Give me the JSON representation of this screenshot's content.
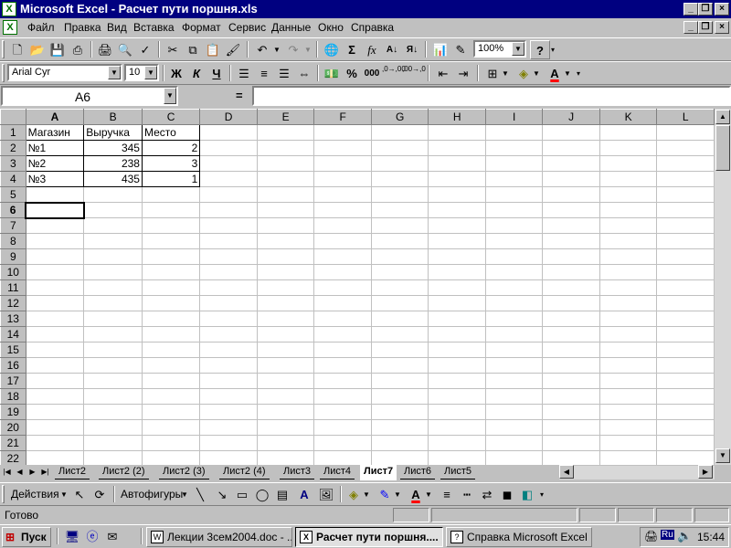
{
  "window": {
    "title": "Microsoft Excel - Расчет пути поршня.xls",
    "minimize": "_",
    "restore": "❐",
    "close": "×"
  },
  "menu": {
    "items": [
      "Файл",
      "Правка",
      "Вид",
      "Вставка",
      "Формат",
      "Сервис",
      "Данные",
      "Окно",
      "Справка"
    ],
    "underline": [
      "Ф",
      "П",
      "В",
      "а",
      "о",
      "С",
      "Д",
      "О",
      "С"
    ]
  },
  "toolbar_standard": {
    "zoom": "100%",
    "help": "?"
  },
  "toolbar_format": {
    "font": "Arial Cyr",
    "size": "10",
    "bold": "Ж",
    "italic": "К",
    "underline": "Ч",
    "percent": "%",
    "thousands": "000",
    "inc_decimal": ",0→,00",
    "dec_decimal": ",00→,0"
  },
  "formula_bar": {
    "name_box": "A6",
    "equals": "=",
    "value": ""
  },
  "sheet": {
    "columns": [
      "A",
      "B",
      "C",
      "D",
      "E",
      "F",
      "G",
      "H",
      "I",
      "J",
      "K",
      "L"
    ],
    "active_col": "A",
    "active_row": 6,
    "rows": [
      [
        "Магазин",
        "Выручка",
        "Место",
        "",
        "",
        "",
        "",
        "",
        "",
        "",
        "",
        ""
      ],
      [
        "№1",
        "345",
        "2",
        "",
        "",
        "",
        "",
        "",
        "",
        "",
        "",
        ""
      ],
      [
        "№2",
        "238",
        "3",
        "",
        "",
        "",
        "",
        "",
        "",
        "",
        "",
        ""
      ],
      [
        "№3",
        "435",
        "1",
        "",
        "",
        "",
        "",
        "",
        "",
        "",
        "",
        ""
      ],
      [
        "",
        "",
        "",
        "",
        "",
        "",
        "",
        "",
        "",
        "",
        "",
        ""
      ],
      [
        "",
        "",
        "",
        "",
        "",
        "",
        "",
        "",
        "",
        "",
        "",
        ""
      ],
      [
        "",
        "",
        "",
        "",
        "",
        "",
        "",
        "",
        "",
        "",
        "",
        ""
      ],
      [
        "",
        "",
        "",
        "",
        "",
        "",
        "",
        "",
        "",
        "",
        "",
        ""
      ],
      [
        "",
        "",
        "",
        "",
        "",
        "",
        "",
        "",
        "",
        "",
        "",
        ""
      ],
      [
        "",
        "",
        "",
        "",
        "",
        "",
        "",
        "",
        "",
        "",
        "",
        ""
      ],
      [
        "",
        "",
        "",
        "",
        "",
        "",
        "",
        "",
        "",
        "",
        "",
        ""
      ],
      [
        "",
        "",
        "",
        "",
        "",
        "",
        "",
        "",
        "",
        "",
        "",
        ""
      ],
      [
        "",
        "",
        "",
        "",
        "",
        "",
        "",
        "",
        "",
        "",
        "",
        ""
      ],
      [
        "",
        "",
        "",
        "",
        "",
        "",
        "",
        "",
        "",
        "",
        "",
        ""
      ],
      [
        "",
        "",
        "",
        "",
        "",
        "",
        "",
        "",
        "",
        "",
        "",
        ""
      ],
      [
        "",
        "",
        "",
        "",
        "",
        "",
        "",
        "",
        "",
        "",
        "",
        ""
      ],
      [
        "",
        "",
        "",
        "",
        "",
        "",
        "",
        "",
        "",
        "",
        "",
        ""
      ],
      [
        "",
        "",
        "",
        "",
        "",
        "",
        "",
        "",
        "",
        "",
        "",
        ""
      ],
      [
        "",
        "",
        "",
        "",
        "",
        "",
        "",
        "",
        "",
        "",
        "",
        ""
      ],
      [
        "",
        "",
        "",
        "",
        "",
        "",
        "",
        "",
        "",
        "",
        "",
        ""
      ],
      [
        "",
        "",
        "",
        "",
        "",
        "",
        "",
        "",
        "",
        "",
        "",
        ""
      ],
      [
        "",
        "",
        "",
        "",
        "",
        "",
        "",
        "",
        "",
        "",
        "",
        ""
      ]
    ]
  },
  "tabs": {
    "sheets": [
      "Лист2",
      "Лист2 (2)",
      "Лист2 (3)",
      "Лист2 (4)",
      "Лист3",
      "Лист4",
      "Лист7",
      "Лист6",
      "Лист5"
    ],
    "active": "Лист7"
  },
  "drawing": {
    "actions": "Действия",
    "autoshapes": "Автофигуры"
  },
  "status": {
    "text": "Готово"
  },
  "taskbar": {
    "start": "Пуск",
    "tasks": [
      "Лекции 3сем2004.doc - ...",
      "Расчет пути поршня....",
      "Справка Microsoft Excel"
    ],
    "active_task": 1,
    "lang": "Ru",
    "clock": "15:44"
  }
}
